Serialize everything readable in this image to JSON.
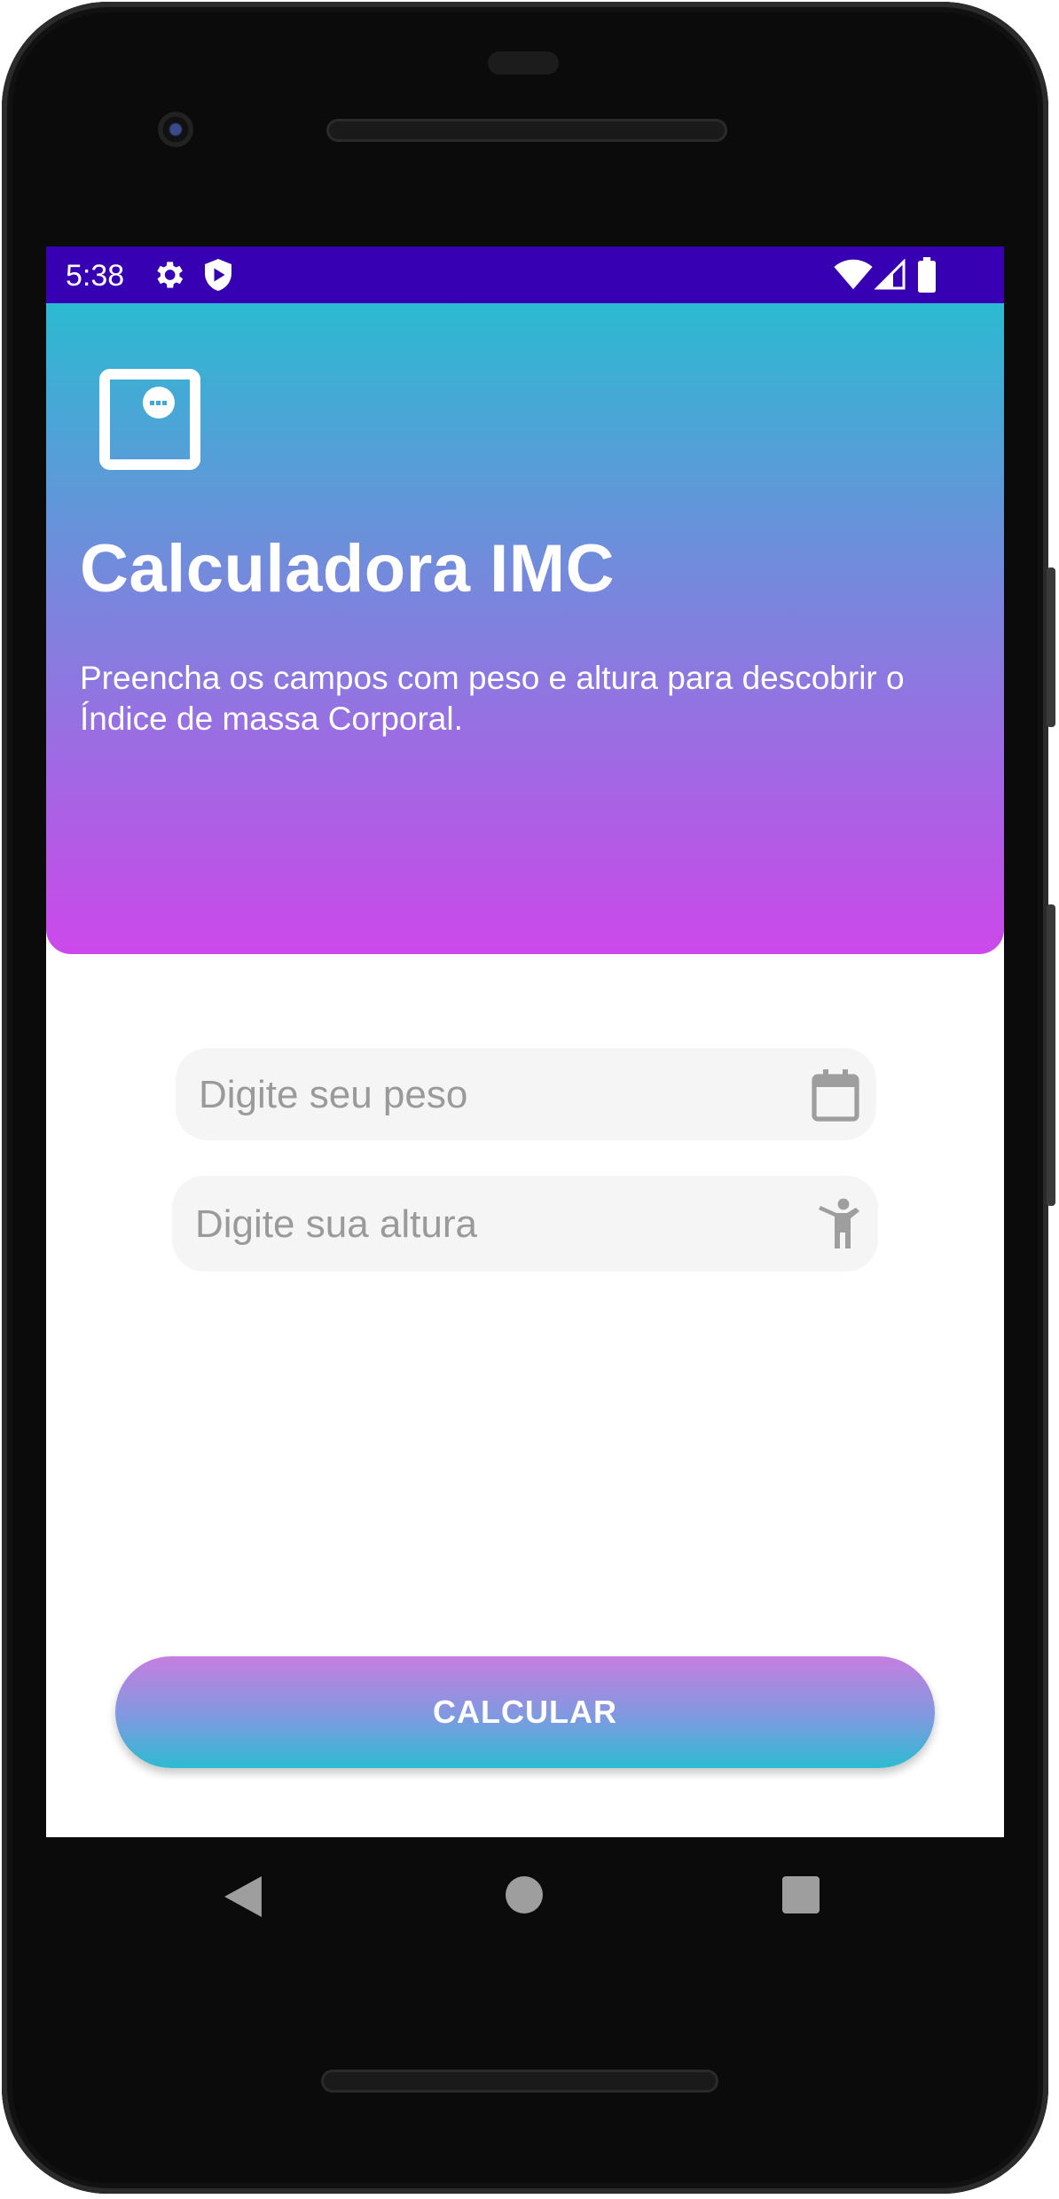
{
  "status_bar": {
    "time": "5:38",
    "icons": [
      "gear-icon",
      "shield-icon",
      "wifi-icon",
      "signal-icon",
      "battery-icon"
    ]
  },
  "header": {
    "title": "Calculadora IMC",
    "subtitle": "Preencha os campos com peso e altura para descobrir o Índice de massa Corporal.",
    "logo_icon": "scale-icon"
  },
  "form": {
    "weight_placeholder": "Digite seu peso",
    "weight_value": "",
    "weight_icon": "calendar-icon",
    "height_placeholder": "Digite sua altura",
    "height_value": "",
    "height_icon": "person-height-icon"
  },
  "actions": {
    "calculate_label": "CALCULAR"
  },
  "colors": {
    "status_bar": "#3700b3",
    "header_gradient_top": "#2bbad1",
    "header_gradient_bottom": "#cc48ea",
    "button_gradient_top": "#c67ee0",
    "button_gradient_bottom": "#2dbcd1",
    "field_background": "#f5f5f5"
  },
  "nav_bar": {
    "icons": [
      "back-icon",
      "home-icon",
      "recents-icon"
    ]
  }
}
